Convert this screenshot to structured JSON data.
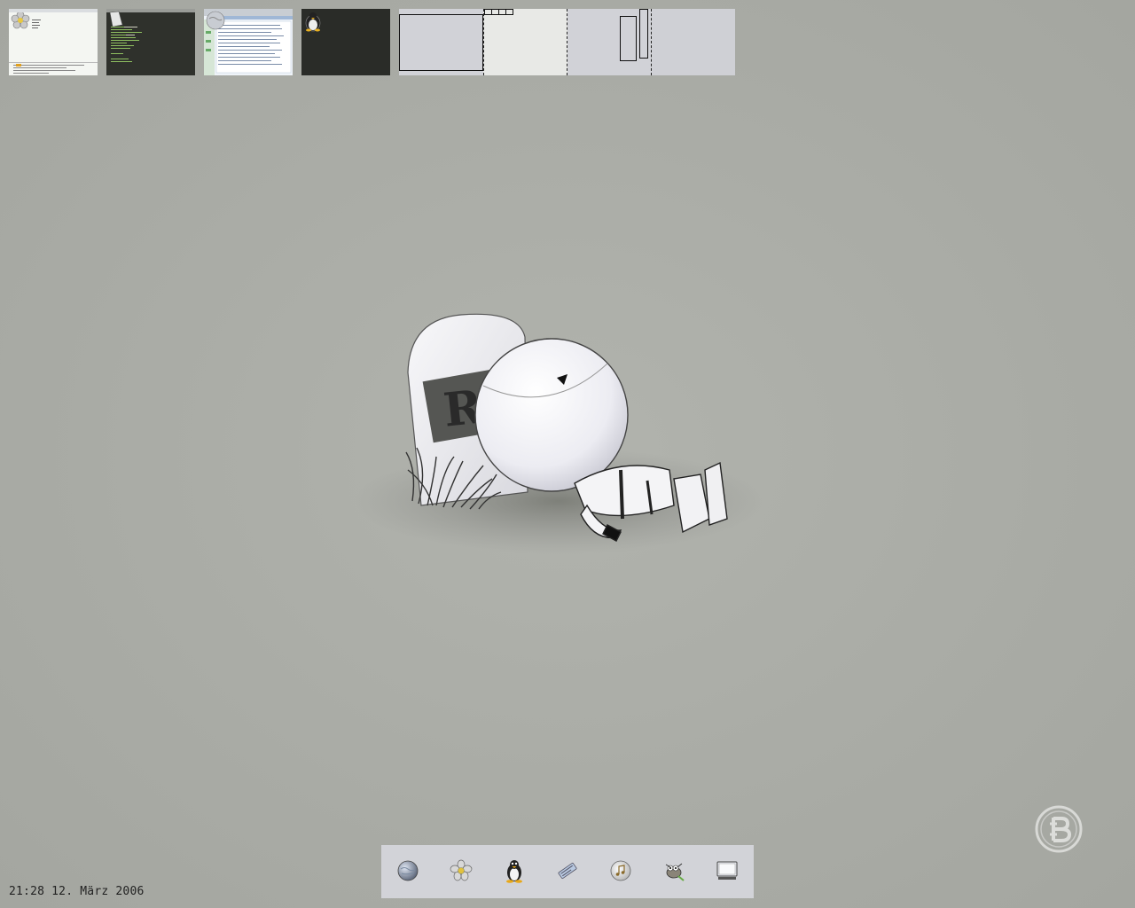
{
  "thumbnails": [
    {
      "name": "window-thumbnail-file-manager",
      "icon": "flower-icon",
      "bg": "#f4f6f2"
    },
    {
      "name": "window-thumbnail-terminal",
      "icon": "file-icon",
      "bg": "#2f312c"
    },
    {
      "name": "window-thumbnail-browser",
      "icon": "globe-icon",
      "bg": "#eef3f8"
    },
    {
      "name": "window-thumbnail-console",
      "icon": "tux-icon",
      "bg": "#2a2c28"
    }
  ],
  "pager": {
    "desktops": 4,
    "active_desktop": 2
  },
  "wallpaper": {
    "tombstone_text": "RI"
  },
  "dock": {
    "items": [
      {
        "name": "globe-icon"
      },
      {
        "name": "flower-icon"
      },
      {
        "name": "tux-icon"
      },
      {
        "name": "text-editor-icon"
      },
      {
        "name": "music-cd-icon"
      },
      {
        "name": "gimp-icon"
      },
      {
        "name": "monitor-icon"
      }
    ]
  },
  "clock": {
    "text": "21:28 12. März 2006"
  },
  "colors": {
    "desktop": "#aaaca6",
    "dock": "#d2d3d8",
    "pager": "#d1d2d7"
  }
}
